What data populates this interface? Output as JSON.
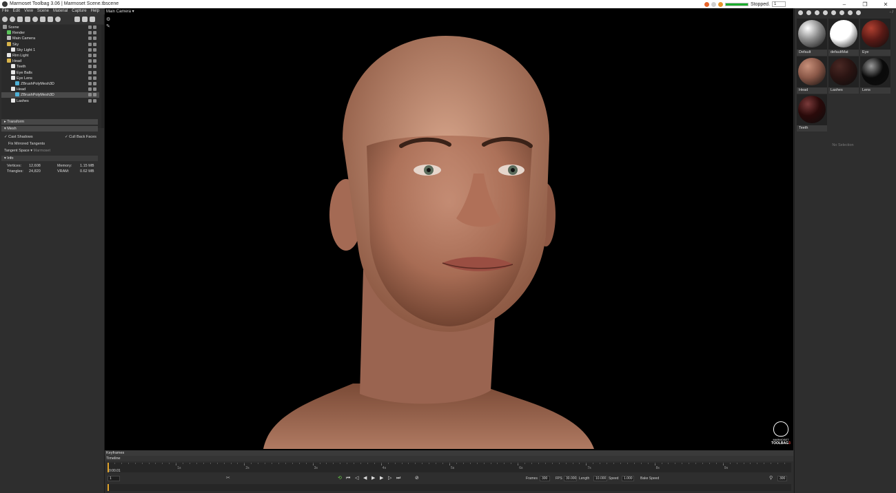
{
  "window": {
    "title": "Marmoset Toolbag 3.06  |  Marmoset Scene.tbscene",
    "status": "Stopped.",
    "status_value": "1",
    "progress_pct": 100,
    "minimize": "–",
    "maximize": "❐",
    "close": "✕"
  },
  "menu": [
    "File",
    "Edit",
    "View",
    "Scene",
    "Material",
    "Capture",
    "Help"
  ],
  "scene_tree": [
    {
      "label": "Scene",
      "depth": 0,
      "icon": "scene-icon",
      "color": "#9a9a9a"
    },
    {
      "label": "Render",
      "depth": 1,
      "icon": "render-icon",
      "color": "#5bc45b"
    },
    {
      "label": "Main Camera",
      "depth": 1,
      "icon": "camera-icon",
      "color": "#bbbbbb"
    },
    {
      "label": "Sky",
      "depth": 1,
      "icon": "sky-icon",
      "color": "#d9b44a"
    },
    {
      "label": "Sky Light 1",
      "depth": 2,
      "icon": "light-icon",
      "color": "#e8e8e8"
    },
    {
      "label": "Rim Light",
      "depth": 1,
      "icon": "light-icon",
      "color": "#e8e8e8"
    },
    {
      "label": "Head",
      "depth": 1,
      "icon": "folder-icon",
      "color": "#d9b44a"
    },
    {
      "label": "Teeth",
      "depth": 2,
      "icon": "mesh-icon",
      "color": "#e8e8e8"
    },
    {
      "label": "Eye Balls",
      "depth": 2,
      "icon": "mesh-icon",
      "color": "#e8e8e8"
    },
    {
      "label": "Eye Lens",
      "depth": 2,
      "icon": "mesh-icon",
      "color": "#e8e8e8"
    },
    {
      "label": "ZBrushPolyMesh3D",
      "depth": 3,
      "icon": "mesh-icon",
      "color": "#4fb0d6"
    },
    {
      "label": "Head",
      "depth": 2,
      "icon": "mesh-icon",
      "color": "#e8e8e8"
    },
    {
      "label": "ZBrushPolyMesh3D",
      "depth": 3,
      "icon": "mesh-icon",
      "color": "#4fb0d6",
      "selected": true
    },
    {
      "label": "Lashes",
      "depth": 2,
      "icon": "mesh-icon",
      "color": "#e8e8e8"
    }
  ],
  "properties": {
    "transform": "Transform",
    "mesh": "Mesh",
    "cast_shadows": "Cast Shadows",
    "cull_back_faces": "Cull Back Faces",
    "fix_mirrored": "Fix Mirrored Tangents",
    "tangent_space_label": "Tangent Space",
    "tangent_space_value": "Marmoset",
    "info": "Info",
    "vertices_label": "Vertices:",
    "vertices_value": "12,608",
    "memory_label": "Memory:",
    "memory_value": "1.15 MB",
    "triangles_label": "Triangles:",
    "triangles_value": "24,820",
    "vram_label": "VRAM:",
    "vram_value": "0.62 MB"
  },
  "viewport": {
    "camera": "Main Camera ▾",
    "logo_line1": "MARMOSET",
    "logo_line2": "TOOLBAG",
    "logo_num": "3"
  },
  "materials": [
    {
      "name": "Default",
      "color": "#8a8a8a",
      "highlight": "#ffffff"
    },
    {
      "name": "defaultMat",
      "color": "#ffffff",
      "highlight": "#ffffff"
    },
    {
      "name": "Eye",
      "color": "#5a1a16",
      "highlight": "#b04030"
    },
    {
      "name": "Head",
      "color": "#8a5848",
      "highlight": "#c8907a"
    },
    {
      "name": "Lashes",
      "color": "#2a1412",
      "highlight": "#4a2824"
    },
    {
      "name": "Lens",
      "color": "#0a0a0a",
      "highlight": "#9a9a9a"
    },
    {
      "name": "Teeth",
      "color": "#2a0a0a",
      "highlight": "#7a3a3a"
    }
  ],
  "right_panel": {
    "no_selection": "No Selection",
    "icons": [
      "add-icon",
      "duplicate-icon",
      "link-icon",
      "folder-icon",
      "delete-icon",
      "picker-icon",
      "check-icon",
      "gear-icon"
    ],
    "zoom": "- /"
  },
  "timeline": {
    "keyframes": "Keyframes",
    "timeline": "Timeline",
    "ticks": [
      "1s",
      "2s",
      "3s",
      "4s",
      "5s",
      "6s",
      "7s",
      "8s",
      "9s"
    ],
    "time": "0:00.01",
    "frame": "1",
    "frames_label": "Frames",
    "frames_value": "300",
    "fps_label": "FPS",
    "fps_value": "30.000",
    "length_label": "Length",
    "length_value": "10.000",
    "speed_label": "Speed",
    "speed_value": "1.000",
    "bake_speed": "Bake Speed",
    "end_value": "300"
  }
}
